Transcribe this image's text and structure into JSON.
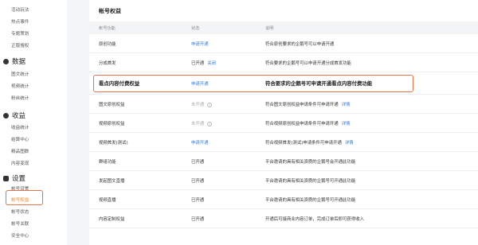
{
  "sidebar": {
    "top_items": [
      "活动玩法",
      "热点事件",
      "专题策划",
      "正版搜权"
    ],
    "sections": [
      {
        "title": "数据",
        "icon": "pie-chart-icon",
        "items": [
          "图文统计",
          "视频统计",
          "粉丝统计"
        ]
      },
      {
        "title": "收益",
        "icon": "income-icon",
        "items": [
          "收益统计",
          "结算中心",
          "精品图数",
          "内容变现"
        ]
      },
      {
        "title": "设置",
        "icon": "settings-icon",
        "items": [
          "帐号设置",
          "帐号权益",
          "帐号状态",
          "帐号关联",
          "安全中心"
        ]
      }
    ],
    "active_item": "帐号权益"
  },
  "page": {
    "title": "帐号权益",
    "columns": [
      "帐号功能",
      "状态",
      "说明"
    ]
  },
  "table": [
    {
      "name": "原创功能",
      "status": "申请开通",
      "status_style": "blue",
      "desc": "符合原创要求的企鹅号可以申请开通",
      "link": ""
    },
    {
      "name": "分成首发",
      "status": "已开通",
      "status_link": "关闭",
      "status_style": "normal",
      "desc": "符合要求的企鹅号可以申请开通分成首发功能",
      "link": ""
    },
    {
      "name": "看点内容付费权益",
      "status": "申请开通",
      "status_style": "blue",
      "desc": "符合要求的企鹅号可申请开通看点内容付费功能",
      "link": ""
    },
    {
      "name": "图文原创权益",
      "status": "未开通",
      "status_style": "grey",
      "help": true,
      "desc": "符合图文原创权益申请条件可申请开通",
      "link": "详情"
    },
    {
      "name": "视频原创权益",
      "status": "未开通",
      "status_style": "grey",
      "help": true,
      "desc": "符合视频原创权益申请条件可申请开通",
      "link": "详情"
    },
    {
      "name": "视频首发(测试)",
      "status": "申请开通",
      "status_style": "blue",
      "desc": "符合视频首发(测试)申请条件可申请开通",
      "link": "详情"
    },
    {
      "name": "群组功能",
      "status": "已开通",
      "status_style": "normal",
      "desc": "平台邀请的具有相关资质的企鹅号会开通此功能",
      "link": ""
    },
    {
      "name": "发起图文直播",
      "status": "已开通",
      "status_style": "normal",
      "desc": "平台邀请的具有相关资质的企鹅号可开通此功能",
      "link": ""
    },
    {
      "name": "视频直播",
      "status": "已开通",
      "status_style": "normal",
      "desc": "平台邀请的具有相关资质的企鹅号可开通此功能",
      "link": ""
    },
    {
      "name": "内容定制权益",
      "status": "已开通",
      "status_style": "normal",
      "desc": "开通后可接商业内容订单，完成订单后即可获得收入",
      "link": ""
    }
  ],
  "colors": {
    "accent": "#3a7bd5",
    "highlight": "#e8734a",
    "active": "#f08a2b"
  }
}
